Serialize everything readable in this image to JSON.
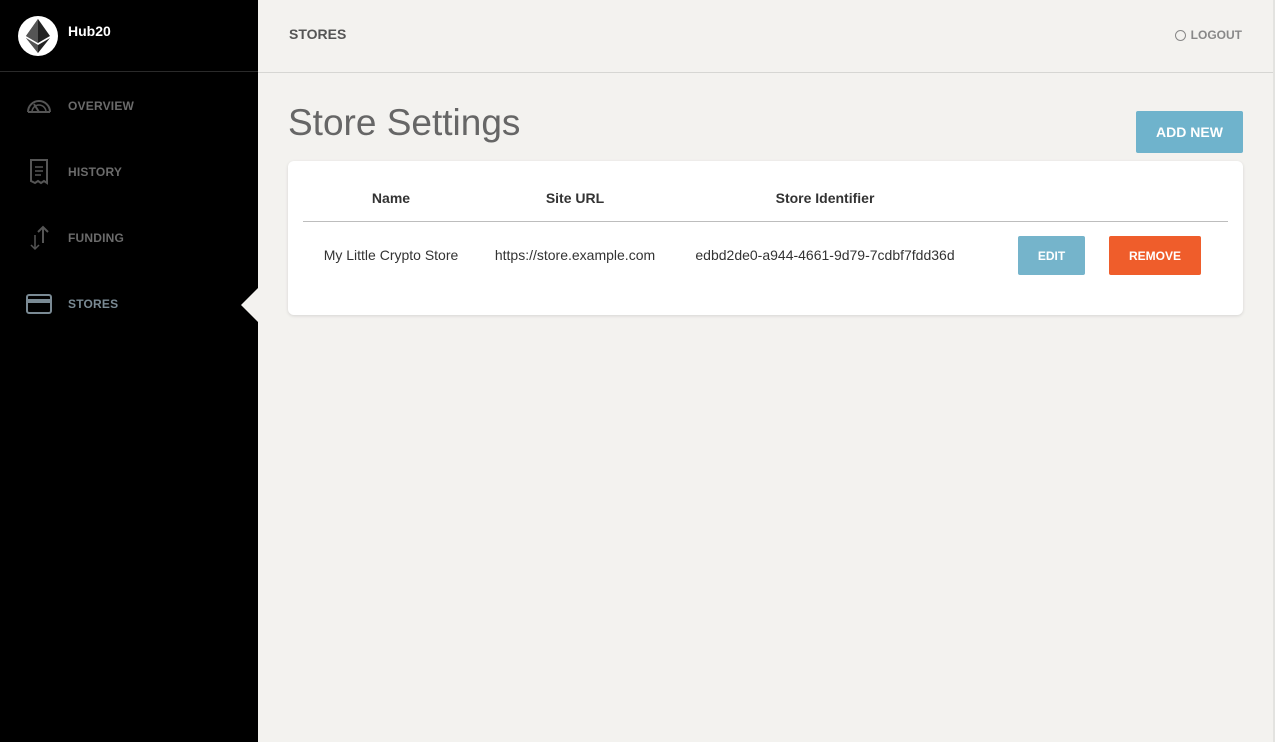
{
  "brand": {
    "name": "Hub20"
  },
  "sidebar": {
    "items": [
      {
        "label": "OVERVIEW",
        "icon": "gauge-icon"
      },
      {
        "label": "HISTORY",
        "icon": "receipt-icon"
      },
      {
        "label": "FUNDING",
        "icon": "transfer-arrows-icon"
      },
      {
        "label": "STORES",
        "icon": "credit-card-icon",
        "active": true
      }
    ]
  },
  "topbar": {
    "title": "STORES",
    "logout_label": "LOGOUT"
  },
  "main": {
    "title": "Store Settings",
    "add_new_label": "ADD NEW",
    "table": {
      "headers": [
        "Name",
        "Site URL",
        "Store Identifier"
      ],
      "rows": [
        {
          "name": "My Little Crypto Store",
          "site_url": "https://store.example.com",
          "identifier": "edbd2de0-a944-4661-9d79-7cdbf7fdd36d",
          "edit_label": "EDIT",
          "remove_label": "REMOVE"
        }
      ]
    }
  },
  "colors": {
    "sidebar_bg": "#000000",
    "content_bg": "#f3f2ef",
    "accent_blue": "#6fb3cc",
    "danger_orange": "#ef5d2b"
  }
}
